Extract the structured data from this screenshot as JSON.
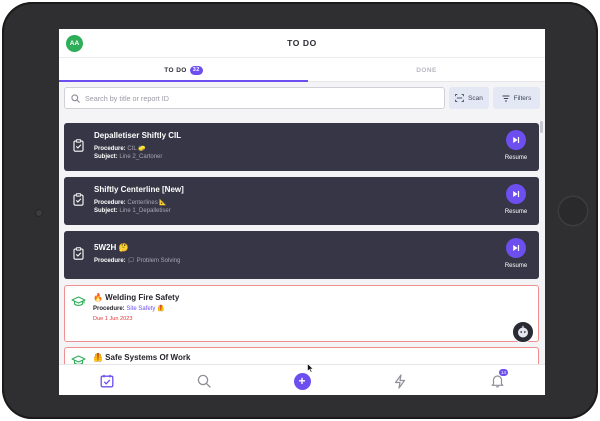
{
  "header": {
    "avatar_initials": "AA",
    "title": "TO DO"
  },
  "tabs": [
    {
      "label": "TO DO",
      "count": "32",
      "active": true
    },
    {
      "label": "DONE",
      "active": false
    }
  ],
  "search": {
    "placeholder": "Search by title or report ID",
    "value": ""
  },
  "toolbar": {
    "scan_label": "Scan",
    "filters_label": "Filters"
  },
  "tasks": [
    {
      "title": "Depalletiser Shiftly CIL",
      "procedure_label": "Procedure:",
      "procedure": "CIL 🧽",
      "subject_label": "Subject:",
      "subject": "Line 2_Cartoner",
      "action": "Resume",
      "style": "in-progress"
    },
    {
      "title": "Shiftly Centerline [New]",
      "procedure_label": "Procedure:",
      "procedure": "Centerlines 📐",
      "subject_label": "Subject:",
      "subject": "Line 1_Depalletiser",
      "action": "Resume",
      "style": "in-progress"
    },
    {
      "title": "5W2H 🤔",
      "procedure_label": "Procedure:",
      "procedure": "🗯 Problem Solving",
      "action": "Resume",
      "style": "in-progress"
    },
    {
      "title": "🔥 Welding Fire Safety",
      "procedure_label": "Procedure:",
      "procedure": "Site Safety 🦺",
      "due": "Due 1 Jun 2023",
      "style": "overdue"
    },
    {
      "title": "🦺 Safe Systems Of Work",
      "style": "overdue"
    }
  ],
  "bottom_nav": [
    {
      "name": "calendar-check-icon",
      "active": true
    },
    {
      "name": "search-icon"
    },
    {
      "name": "add-icon",
      "label": "+"
    },
    {
      "name": "lightning-icon"
    },
    {
      "name": "bell-icon",
      "badge": "14"
    }
  ],
  "colors": {
    "accent": "#6d4ff0",
    "card_dark": "#373646",
    "overdue_border": "#ef8f8f",
    "due_text": "#e23a3a",
    "avatar_green": "#2fae5a"
  }
}
